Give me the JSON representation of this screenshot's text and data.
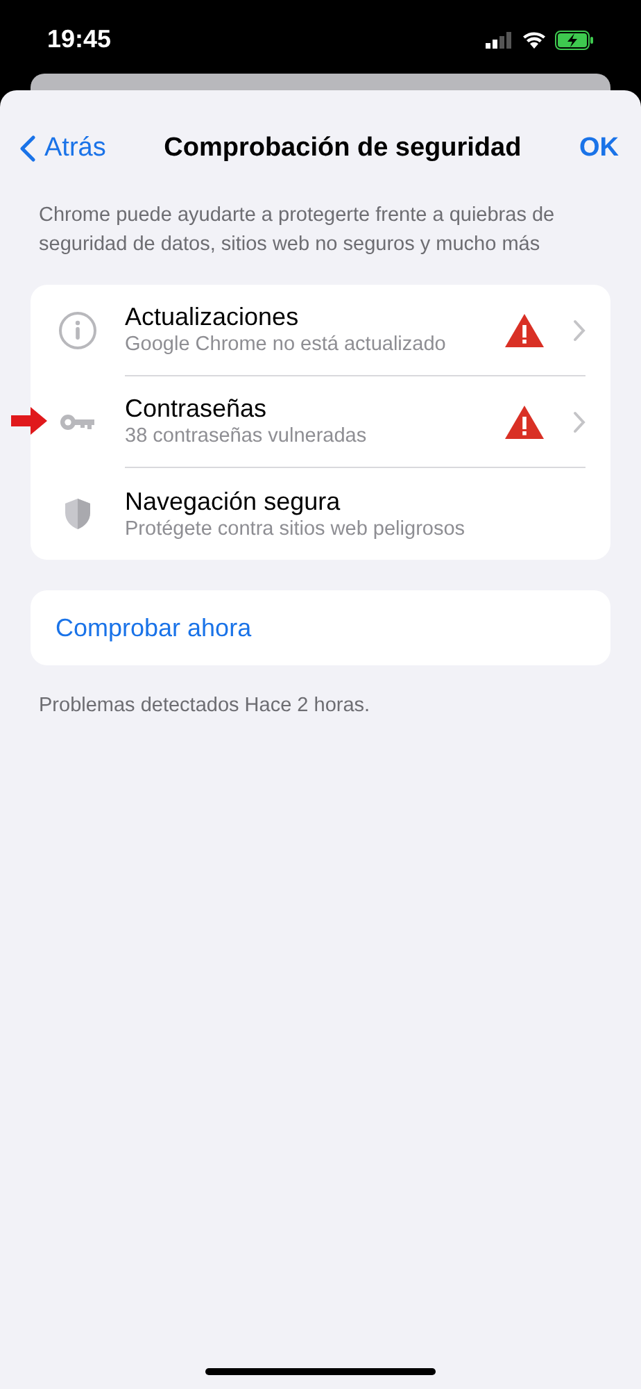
{
  "status_bar": {
    "time": "19:45"
  },
  "nav": {
    "back": "Atrás",
    "title": "Comprobación de seguridad",
    "done": "OK"
  },
  "description": "Chrome puede ayudarte a protegerte frente a quiebras de seguridad de datos, sitios web no seguros y mucho más",
  "checks": [
    {
      "kind": "info",
      "title": "Actualizaciones",
      "subtitle": "Google Chrome no está actualizado",
      "warning": true,
      "chevron": true
    },
    {
      "kind": "key",
      "title": "Contraseñas",
      "subtitle": "38 contraseñas vulneradas",
      "warning": true,
      "chevron": true
    },
    {
      "kind": "shield",
      "title": "Navegación segura",
      "subtitle": "Protégete contra sitios web peligrosos",
      "warning": false,
      "chevron": false
    }
  ],
  "action": "Comprobar ahora",
  "footer": "Problemas detectados Hace 2 horas."
}
